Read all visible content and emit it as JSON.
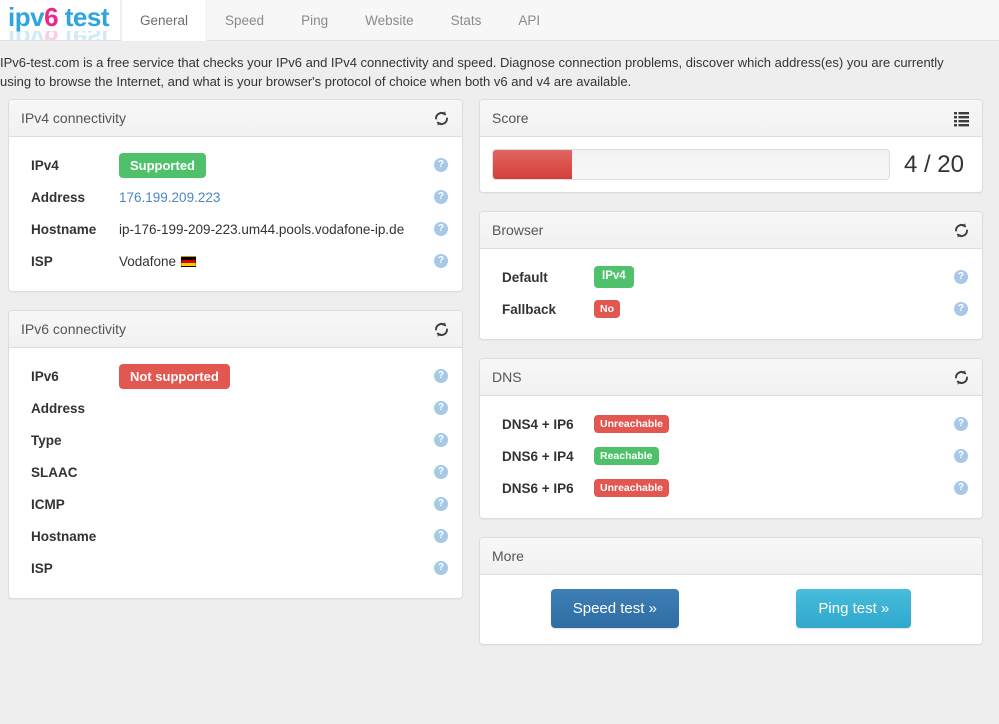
{
  "brand": {
    "pre": "ipv",
    "six": "6",
    "post": " test"
  },
  "nav": {
    "tabs": [
      {
        "label": "General",
        "active": true
      },
      {
        "label": "Speed",
        "active": false
      },
      {
        "label": "Ping",
        "active": false
      },
      {
        "label": "Website",
        "active": false
      },
      {
        "label": "Stats",
        "active": false
      },
      {
        "label": "API",
        "active": false
      }
    ]
  },
  "intro": {
    "text": "IPv6-test.com is a free service that checks your IPv6 and IPv4 connectivity and speed. Diagnose connection problems, discover which address(es) you are currently using to browse the Internet, and what is your browser's protocol of choice when both v6 and v4 are available."
  },
  "icons": {
    "refresh": "refresh-icon",
    "list": "list-icon",
    "help": "?"
  },
  "colors": {
    "green": "#4fc16a",
    "red": "#e2574f",
    "link": "#4a86c8",
    "brand_blue": "#2fa5dd",
    "brand_pink": "#ec268f",
    "speed_button": "#2f6da3",
    "ping_button": "#2fa8cc",
    "page_bg": "#eeeeee"
  },
  "ipv4_panel": {
    "title": "IPv4 connectivity",
    "rows": [
      {
        "label": "IPv4",
        "badge": "Supported",
        "badge_color": "green",
        "value": ""
      },
      {
        "label": "Address",
        "badge": null,
        "value": "176.199.209.223",
        "is_link": true
      },
      {
        "label": "Hostname",
        "badge": null,
        "value": "ip-176-199-209-223.um44.pools.vodafone-ip.de"
      },
      {
        "label": "ISP",
        "badge": null,
        "value": "Vodafone",
        "flag": "Germany"
      }
    ]
  },
  "ipv6_panel": {
    "title": "IPv6 connectivity",
    "rows": [
      {
        "label": "IPv6",
        "badge": "Not supported",
        "badge_color": "red",
        "value": ""
      },
      {
        "label": "Address",
        "badge": null,
        "value": ""
      },
      {
        "label": "Type",
        "badge": null,
        "value": ""
      },
      {
        "label": "SLAAC",
        "badge": null,
        "value": ""
      },
      {
        "label": "ICMP",
        "badge": null,
        "value": ""
      },
      {
        "label": "Hostname",
        "badge": null,
        "value": ""
      },
      {
        "label": "ISP",
        "badge": null,
        "value": ""
      }
    ]
  },
  "score_panel": {
    "title": "Score",
    "value": 4,
    "max": 20,
    "text": "4 / 20",
    "percent": 20
  },
  "browser_panel": {
    "title": "Browser",
    "rows": [
      {
        "label": "Default",
        "badge": "IPv4",
        "badge_color": "green"
      },
      {
        "label": "Fallback",
        "badge": "No",
        "badge_color": "red"
      }
    ]
  },
  "dns_panel": {
    "title": "DNS",
    "rows": [
      {
        "label": "DNS4 + IP6",
        "badge": "Unreachable",
        "badge_color": "red"
      },
      {
        "label": "DNS6 + IP4",
        "badge": "Reachable",
        "badge_color": "green"
      },
      {
        "label": "DNS6 + IP6",
        "badge": "Unreachable",
        "badge_color": "red"
      }
    ]
  },
  "more_panel": {
    "title": "More",
    "speed_button": "Speed test »",
    "ping_button": "Ping test »"
  }
}
